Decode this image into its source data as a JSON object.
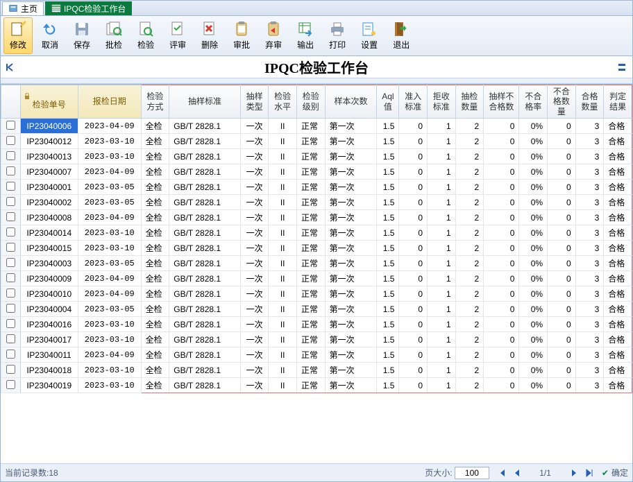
{
  "tabs": {
    "home": "主页",
    "active": "IPQC检验工作台"
  },
  "toolbar": {
    "modify": "修改",
    "cancel": "取消",
    "save": "保存",
    "batch": "批检",
    "inspect": "检验",
    "review": "评审",
    "delete": "删除",
    "approve": "审批",
    "discard": "弃审",
    "export": "输出",
    "print": "打印",
    "settings": "设置",
    "exit": "退出"
  },
  "title": "IPQC检验工作台",
  "columns": [
    "检验单号",
    "报检日期",
    "检验方式",
    "抽样标准",
    "抽样类型",
    "检验水平",
    "检验级别",
    "样本次数",
    "Aql值",
    "准入标准",
    "拒收标准",
    "抽检数量",
    "抽样不合格数",
    "不合格率",
    "不合格数量",
    "合格数量",
    "判定结果"
  ],
  "rows": [
    {
      "id": "IP23040006",
      "date": "2023-04-09",
      "mode": "全检",
      "std": "GB/T 2828.1",
      "type": "一次",
      "lvl": "II",
      "grade": "正常",
      "times": "第一次",
      "aql": "1.5",
      "ac": 0,
      "re": 1,
      "n": 2,
      "nc": 0,
      "rate": "0%",
      "ncqty": 0,
      "okqty": 3,
      "result": "合格",
      "sel": true
    },
    {
      "id": "IP23040012",
      "date": "2023-03-10",
      "mode": "全检",
      "std": "GB/T 2828.1",
      "type": "一次",
      "lvl": "II",
      "grade": "正常",
      "times": "第一次",
      "aql": "1.5",
      "ac": 0,
      "re": 1,
      "n": 2,
      "nc": 0,
      "rate": "0%",
      "ncqty": 0,
      "okqty": 3,
      "result": "合格"
    },
    {
      "id": "IP23040013",
      "date": "2023-03-10",
      "mode": "全检",
      "std": "GB/T 2828.1",
      "type": "一次",
      "lvl": "II",
      "grade": "正常",
      "times": "第一次",
      "aql": "1.5",
      "ac": 0,
      "re": 1,
      "n": 2,
      "nc": 0,
      "rate": "0%",
      "ncqty": 0,
      "okqty": 3,
      "result": "合格"
    },
    {
      "id": "IP23040007",
      "date": "2023-04-09",
      "mode": "全检",
      "std": "GB/T 2828.1",
      "type": "一次",
      "lvl": "II",
      "grade": "正常",
      "times": "第一次",
      "aql": "1.5",
      "ac": 0,
      "re": 1,
      "n": 2,
      "nc": 0,
      "rate": "0%",
      "ncqty": 0,
      "okqty": 3,
      "result": "合格"
    },
    {
      "id": "IP23040001",
      "date": "2023-03-05",
      "mode": "全检",
      "std": "GB/T 2828.1",
      "type": "一次",
      "lvl": "II",
      "grade": "正常",
      "times": "第一次",
      "aql": "1.5",
      "ac": 0,
      "re": 1,
      "n": 2,
      "nc": 0,
      "rate": "0%",
      "ncqty": 0,
      "okqty": 3,
      "result": "合格"
    },
    {
      "id": "IP23040002",
      "date": "2023-03-05",
      "mode": "全检",
      "std": "GB/T 2828.1",
      "type": "一次",
      "lvl": "II",
      "grade": "正常",
      "times": "第一次",
      "aql": "1.5",
      "ac": 0,
      "re": 1,
      "n": 2,
      "nc": 0,
      "rate": "0%",
      "ncqty": 0,
      "okqty": 3,
      "result": "合格"
    },
    {
      "id": "IP23040008",
      "date": "2023-04-09",
      "mode": "全检",
      "std": "GB/T 2828.1",
      "type": "一次",
      "lvl": "II",
      "grade": "正常",
      "times": "第一次",
      "aql": "1.5",
      "ac": 0,
      "re": 1,
      "n": 2,
      "nc": 0,
      "rate": "0%",
      "ncqty": 0,
      "okqty": 3,
      "result": "合格"
    },
    {
      "id": "IP23040014",
      "date": "2023-03-10",
      "mode": "全检",
      "std": "GB/T 2828.1",
      "type": "一次",
      "lvl": "II",
      "grade": "正常",
      "times": "第一次",
      "aql": "1.5",
      "ac": 0,
      "re": 1,
      "n": 2,
      "nc": 0,
      "rate": "0%",
      "ncqty": 0,
      "okqty": 3,
      "result": "合格"
    },
    {
      "id": "IP23040015",
      "date": "2023-03-10",
      "mode": "全检",
      "std": "GB/T 2828.1",
      "type": "一次",
      "lvl": "II",
      "grade": "正常",
      "times": "第一次",
      "aql": "1.5",
      "ac": 0,
      "re": 1,
      "n": 2,
      "nc": 0,
      "rate": "0%",
      "ncqty": 0,
      "okqty": 3,
      "result": "合格"
    },
    {
      "id": "IP23040003",
      "date": "2023-03-05",
      "mode": "全检",
      "std": "GB/T 2828.1",
      "type": "一次",
      "lvl": "II",
      "grade": "正常",
      "times": "第一次",
      "aql": "1.5",
      "ac": 0,
      "re": 1,
      "n": 2,
      "nc": 0,
      "rate": "0%",
      "ncqty": 0,
      "okqty": 3,
      "result": "合格"
    },
    {
      "id": "IP23040009",
      "date": "2023-04-09",
      "mode": "全检",
      "std": "GB/T 2828.1",
      "type": "一次",
      "lvl": "II",
      "grade": "正常",
      "times": "第一次",
      "aql": "1.5",
      "ac": 0,
      "re": 1,
      "n": 2,
      "nc": 0,
      "rate": "0%",
      "ncqty": 0,
      "okqty": 3,
      "result": "合格"
    },
    {
      "id": "IP23040010",
      "date": "2023-04-09",
      "mode": "全检",
      "std": "GB/T 2828.1",
      "type": "一次",
      "lvl": "II",
      "grade": "正常",
      "times": "第一次",
      "aql": "1.5",
      "ac": 0,
      "re": 1,
      "n": 2,
      "nc": 0,
      "rate": "0%",
      "ncqty": 0,
      "okqty": 3,
      "result": "合格"
    },
    {
      "id": "IP23040004",
      "date": "2023-03-05",
      "mode": "全检",
      "std": "GB/T 2828.1",
      "type": "一次",
      "lvl": "II",
      "grade": "正常",
      "times": "第一次",
      "aql": "1.5",
      "ac": 0,
      "re": 1,
      "n": 2,
      "nc": 0,
      "rate": "0%",
      "ncqty": 0,
      "okqty": 3,
      "result": "合格"
    },
    {
      "id": "IP23040016",
      "date": "2023-03-10",
      "mode": "全检",
      "std": "GB/T 2828.1",
      "type": "一次",
      "lvl": "II",
      "grade": "正常",
      "times": "第一次",
      "aql": "1.5",
      "ac": 0,
      "re": 1,
      "n": 2,
      "nc": 0,
      "rate": "0%",
      "ncqty": 0,
      "okqty": 3,
      "result": "合格"
    },
    {
      "id": "IP23040017",
      "date": "2023-03-10",
      "mode": "全检",
      "std": "GB/T 2828.1",
      "type": "一次",
      "lvl": "II",
      "grade": "正常",
      "times": "第一次",
      "aql": "1.5",
      "ac": 0,
      "re": 1,
      "n": 2,
      "nc": 0,
      "rate": "0%",
      "ncqty": 0,
      "okqty": 3,
      "result": "合格"
    },
    {
      "id": "IP23040011",
      "date": "2023-04-09",
      "mode": "全检",
      "std": "GB/T 2828.1",
      "type": "一次",
      "lvl": "II",
      "grade": "正常",
      "times": "第一次",
      "aql": "1.5",
      "ac": 0,
      "re": 1,
      "n": 2,
      "nc": 0,
      "rate": "0%",
      "ncqty": 0,
      "okqty": 3,
      "result": "合格"
    },
    {
      "id": "IP23040018",
      "date": "2023-03-10",
      "mode": "全检",
      "std": "GB/T 2828.1",
      "type": "一次",
      "lvl": "II",
      "grade": "正常",
      "times": "第一次",
      "aql": "1.5",
      "ac": 0,
      "re": 1,
      "n": 2,
      "nc": 0,
      "rate": "0%",
      "ncqty": 0,
      "okqty": 3,
      "result": "合格"
    },
    {
      "id": "IP23040019",
      "date": "2023-03-10",
      "mode": "全检",
      "std": "GB/T 2828.1",
      "type": "一次",
      "lvl": "II",
      "grade": "正常",
      "times": "第一次",
      "aql": "1.5",
      "ac": 0,
      "re": 1,
      "n": 2,
      "nc": 0,
      "rate": "0%",
      "ncqty": 0,
      "okqty": 3,
      "result": "合格"
    }
  ],
  "footer": {
    "count_label": "当前记录数:",
    "count": 18,
    "pagesize_label": "页大小:",
    "pagesize": "100",
    "page": "1/1",
    "ok": "确定"
  }
}
